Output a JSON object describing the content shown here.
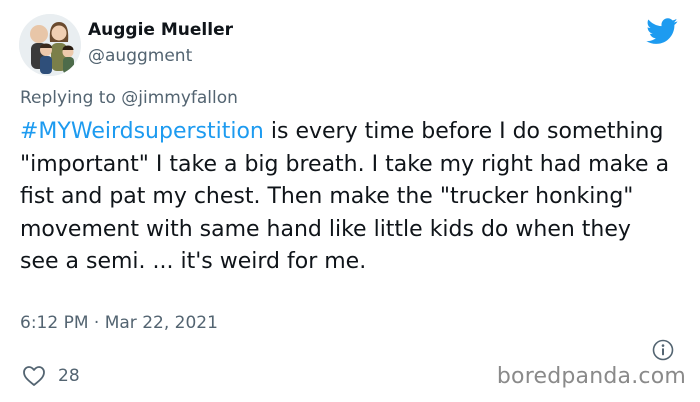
{
  "author": {
    "name": "Auggie Mueller",
    "handle": "@auggment"
  },
  "reply": {
    "prefix": "Replying to",
    "mention": "@jimmyfallon"
  },
  "tweet": {
    "hashtag": "#MYWeirdsuperstition",
    "text": " is every time before I do something \"important\" I take a big breath. I take my right had make a fist and pat my chest. Then make the \"trucker honking\" movement with same hand like little kids do when they see a semi. ... it's weird for me."
  },
  "meta": {
    "time": "6:12 PM",
    "separator": "·",
    "date": "Mar 22, 2021"
  },
  "actions": {
    "like_count": "28"
  },
  "watermark": "boredpanda.com",
  "colors": {
    "accent": "#1d9bf0",
    "secondary_text": "#536471",
    "primary_text": "#0f1419"
  },
  "icons": {
    "brand": "twitter-bird-icon",
    "info": "info-icon",
    "like": "heart-icon"
  }
}
